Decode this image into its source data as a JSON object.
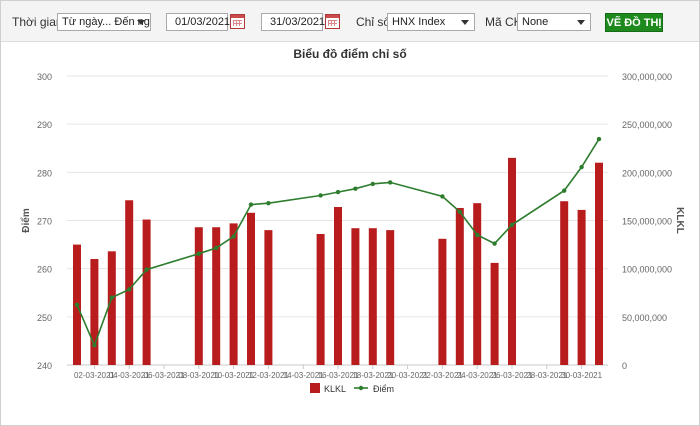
{
  "toolbar": {
    "period_label": "Thời gian",
    "period_select": "Từ ngày... Đến ngày...",
    "from_date": "01/03/2021",
    "to_date": "31/03/2021",
    "index_label": "Chỉ số",
    "index_select": "HNX Index",
    "stock_label": "Mã CK",
    "stock_select": "None",
    "draw_button": "VẼ ĐỒ THỊ"
  },
  "colors": {
    "bar": "#b81c1c",
    "line": "#2e7d2e",
    "button": "#1e8a1e"
  },
  "icons": [
    "calendar-icon",
    "chevron-down-icon"
  ],
  "chart_data": {
    "type": "bar+line",
    "title": "Biểu đồ điểm chỉ số",
    "ylabel_left": "Điểm",
    "ylabel_right": "KLKL",
    "y_left_ticks": [
      "300",
      "290",
      "280",
      "270",
      "260",
      "250",
      "240"
    ],
    "y_left_range": [
      240,
      300
    ],
    "y_right_ticks": [
      "300,000,000",
      "250,000,000",
      "200,000,000",
      "150,000,000",
      "100,000,000",
      "50,000,000",
      "0"
    ],
    "y_right_range": [
      0,
      300000000
    ],
    "x_tick_labels": [
      "02-03-2021",
      "04-03-2021",
      "06-03-2021",
      "08-03-2021",
      "10-03-2021",
      "12-03-2021",
      "14-03-2021",
      "16-03-2021",
      "18-03-2021",
      "20-03-2021",
      "22-03-2021",
      "24-03-2021",
      "26-03-2021",
      "28-03-2021",
      "30-03-2021"
    ],
    "x_days": [
      1,
      31
    ],
    "grid": "horizontal",
    "legend": {
      "position": "bottom",
      "bar_name": "KLKL",
      "line_name": "Điểm"
    },
    "bars": [
      {
        "day": 1,
        "value": 125000000
      },
      {
        "day": 2,
        "value": 110000000
      },
      {
        "day": 3,
        "value": 118000000
      },
      {
        "day": 4,
        "value": 171000000
      },
      {
        "day": 5,
        "value": 151000000
      },
      {
        "day": 8,
        "value": 143000000
      },
      {
        "day": 9,
        "value": 143000000
      },
      {
        "day": 10,
        "value": 147000000
      },
      {
        "day": 11,
        "value": 158000000
      },
      {
        "day": 12,
        "value": 140000000
      },
      {
        "day": 15,
        "value": 136000000
      },
      {
        "day": 16,
        "value": 164000000
      },
      {
        "day": 17,
        "value": 142000000
      },
      {
        "day": 18,
        "value": 142000000
      },
      {
        "day": 19,
        "value": 140000000
      },
      {
        "day": 22,
        "value": 131000000
      },
      {
        "day": 23,
        "value": 163000000
      },
      {
        "day": 24,
        "value": 168000000
      },
      {
        "day": 25,
        "value": 106000000
      },
      {
        "day": 26,
        "value": 215000000
      },
      {
        "day": 29,
        "value": 170000000
      },
      {
        "day": 30,
        "value": 161000000
      },
      {
        "day": 31,
        "value": 210000000
      }
    ],
    "line": [
      {
        "day": 1,
        "value": 252.5
      },
      {
        "day": 2,
        "value": 244.1
      },
      {
        "day": 3,
        "value": 254.0
      },
      {
        "day": 4,
        "value": 255.7
      },
      {
        "day": 5,
        "value": 259.8
      },
      {
        "day": 8,
        "value": 263.1
      },
      {
        "day": 9,
        "value": 264.3
      },
      {
        "day": 10,
        "value": 266.7
      },
      {
        "day": 11,
        "value": 273.3
      },
      {
        "day": 12,
        "value": 273.6
      },
      {
        "day": 15,
        "value": 275.2
      },
      {
        "day": 16,
        "value": 275.9
      },
      {
        "day": 17,
        "value": 276.6
      },
      {
        "day": 18,
        "value": 277.6
      },
      {
        "day": 19,
        "value": 277.9
      },
      {
        "day": 22,
        "value": 275.0
      },
      {
        "day": 23,
        "value": 271.8
      },
      {
        "day": 24,
        "value": 267.0
      },
      {
        "day": 25,
        "value": 265.2
      },
      {
        "day": 26,
        "value": 269.1
      },
      {
        "day": 29,
        "value": 276.2
      },
      {
        "day": 30,
        "value": 281.1
      },
      {
        "day": 31,
        "value": 286.9
      }
    ]
  }
}
